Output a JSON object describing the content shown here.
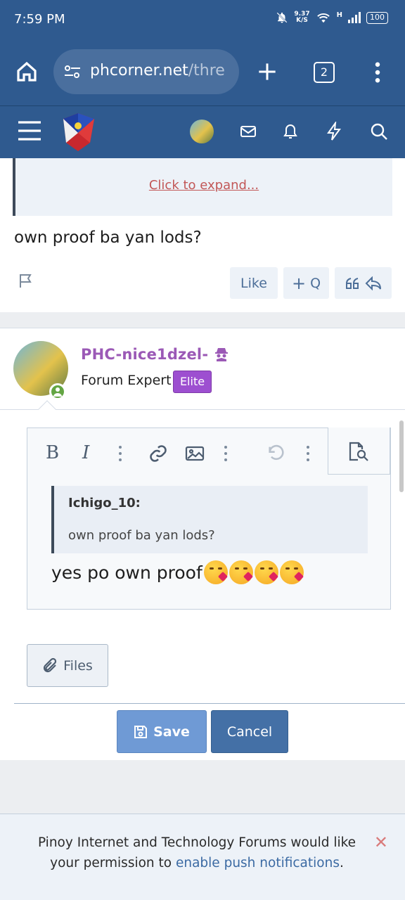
{
  "status_bar": {
    "time": "7:59 PM",
    "net_speed_value": "9.37",
    "net_speed_unit": "K/S",
    "network_label": "H",
    "battery": "100"
  },
  "browser": {
    "url_main": "phcorner.net",
    "url_rest": "/thre",
    "tab_count": "2"
  },
  "post": {
    "expand_link": "Click to expand...",
    "message": "own proof ba yan lods?",
    "like_label": "Like",
    "quick_quote_label": "Q"
  },
  "reply": {
    "username": "PHC-nice1dzel-",
    "user_title": "Forum Expert",
    "badge": "Elite",
    "quote_author": "Ichigo_10:",
    "quote_text": "own proof ba yan lods?",
    "reply_text": "yes po own proof",
    "emoji_count": 4,
    "files_label": "Files",
    "save_label": "Save",
    "cancel_label": "Cancel"
  },
  "notice": {
    "text_before": "Pinoy Internet and Technology Forums would like your permission to ",
    "link_text": "enable push notifications",
    "text_after": "."
  },
  "colors": {
    "header_blue": "#2f5a8f",
    "username_purple": "#9b59b6",
    "badge_purple": "#9d4fd0",
    "save_blue": "#6f9ad5",
    "cancel_blue": "#4470a6"
  }
}
